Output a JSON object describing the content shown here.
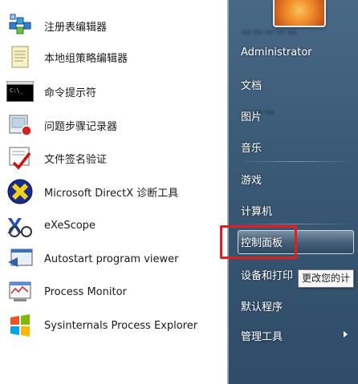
{
  "programs": [
    {
      "label": "注册表编辑器",
      "icon": "registry-editor-icon"
    },
    {
      "label": "本地组策略编辑器",
      "icon": "group-policy-icon"
    },
    {
      "label": "命令提示符",
      "icon": "command-prompt-icon"
    },
    {
      "label": "问题步骤记录器",
      "icon": "steps-recorder-icon"
    },
    {
      "label": "文件签名验证",
      "icon": "file-signature-icon"
    },
    {
      "label": "Microsoft DirectX 诊断工具",
      "icon": "directx-icon"
    },
    {
      "label": "eXeScope",
      "icon": "exescope-icon"
    },
    {
      "label": "Autostart program viewer",
      "icon": "autostart-icon"
    },
    {
      "label": "Process Monitor",
      "icon": "process-monitor-icon"
    },
    {
      "label": "Sysinternals Process Explorer",
      "icon": "process-explorer-icon"
    }
  ],
  "right_menu": {
    "user": "Administrator",
    "items": [
      "文档",
      "图片",
      "音乐",
      "游戏",
      "计算机",
      "控制面板",
      "设备和打印",
      "默认程序",
      "管理工具"
    ],
    "tooltip": "更改您的计"
  },
  "colors": {
    "highlight_border": "#e02020"
  }
}
